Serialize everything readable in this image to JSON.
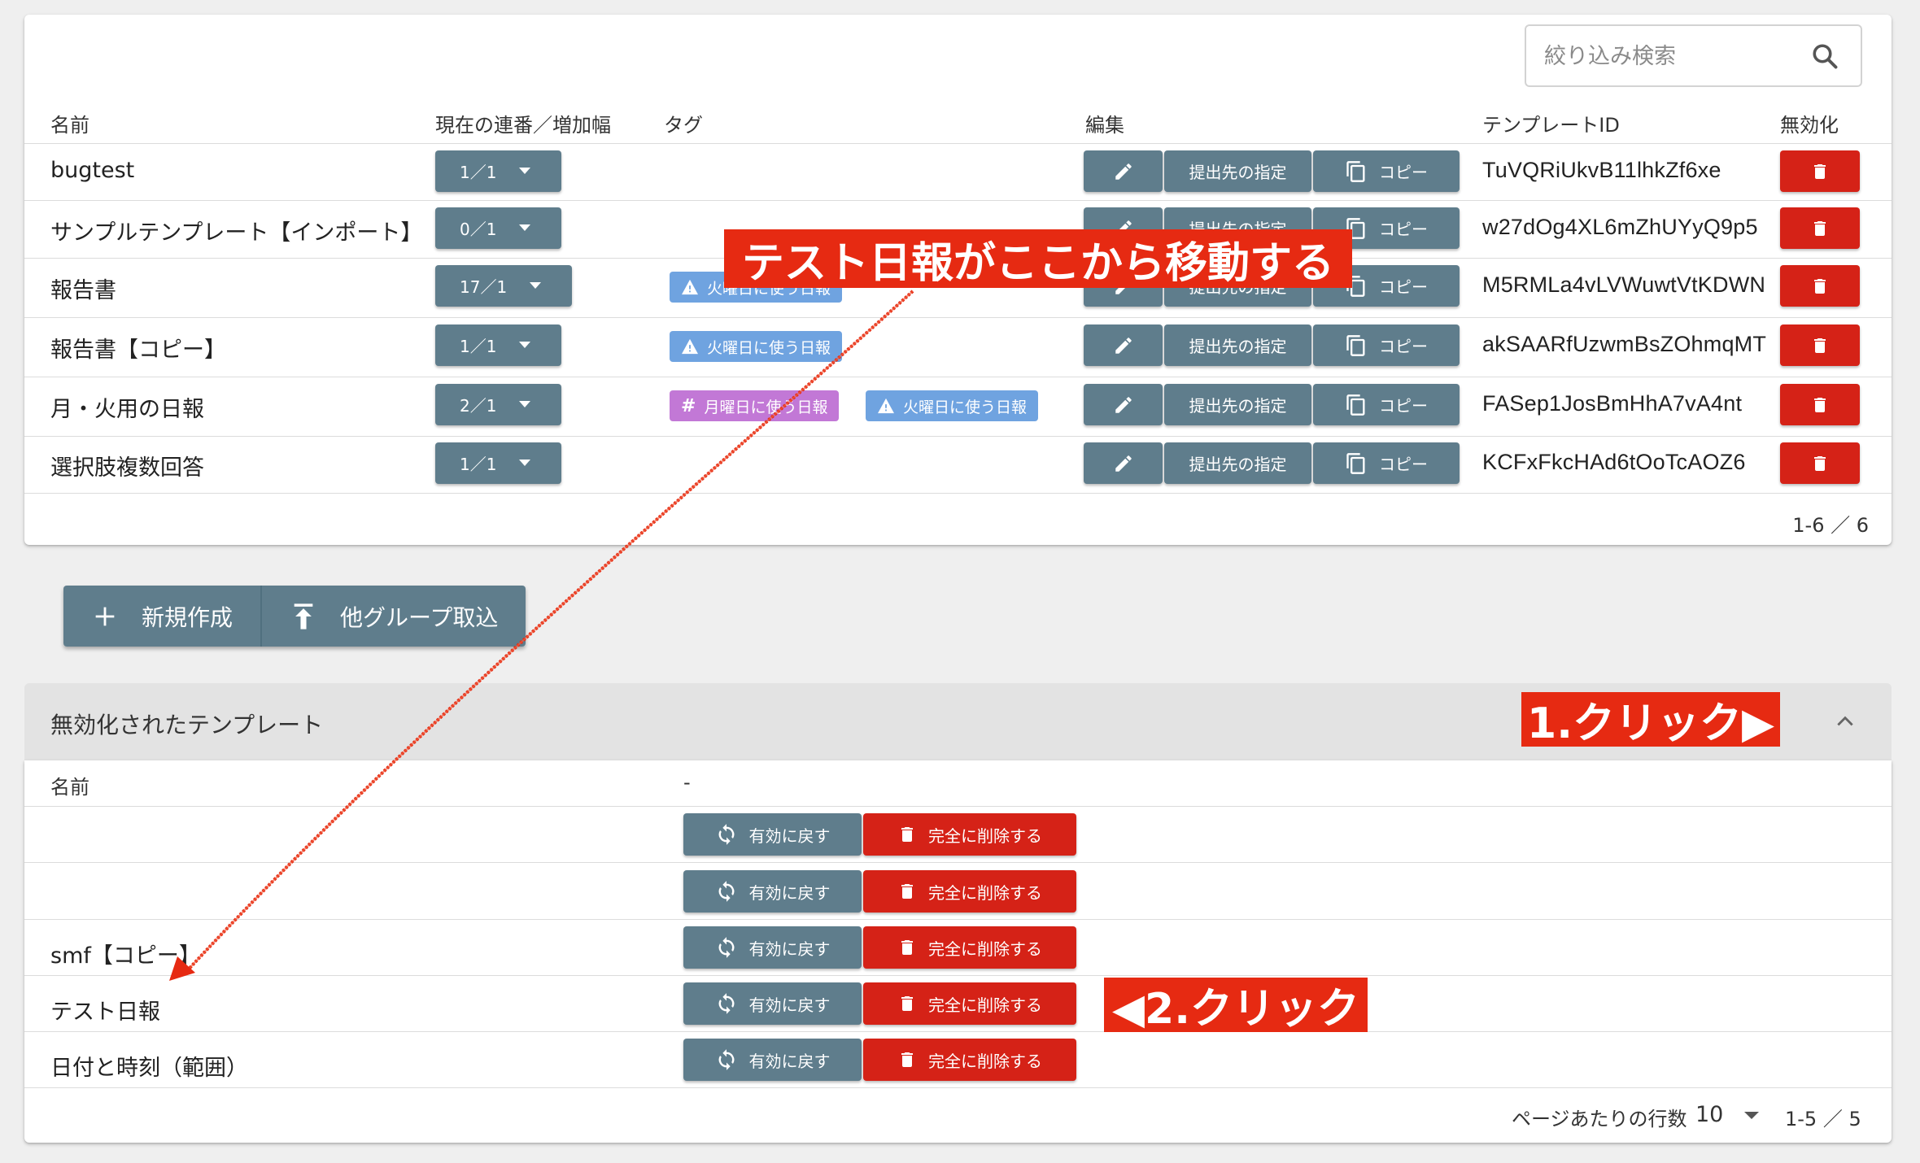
{
  "search": {
    "placeholder": "絞り込み検索",
    "icon": "search-icon"
  },
  "table": {
    "headers": [
      "名前",
      "現在の連番／増加幅",
      "タグ",
      "編集",
      "テンプレートID",
      "無効化"
    ],
    "rows": [
      {
        "name": "bugtest",
        "seq": "1／1",
        "tags": [],
        "id": "TuVQRiUkvB11lhkZf6xe"
      },
      {
        "name": "サンプルテンプレート【インポート】",
        "seq": "0／1",
        "tags": [],
        "id": "w27dOg4XL6mZhUYyQ9p5"
      },
      {
        "name": "報告書",
        "seq": "17／1",
        "tags": [
          {
            "label": "火曜日に使う日報",
            "type": "warning"
          }
        ],
        "id": "M5RMLa4vLVWuwtVtKDWN"
      },
      {
        "name": "報告書【コピー】",
        "seq": "1／1",
        "tags": [
          {
            "label": "火曜日に使う日報",
            "type": "warning"
          }
        ],
        "id": "akSAARfUzwmBsZOhmqMT"
      },
      {
        "name": "月・火用の日報",
        "seq": "2／1",
        "tags": [
          {
            "label": "月曜日に使う日報",
            "type": "hash"
          },
          {
            "label": "火曜日に使う日報",
            "type": "warning"
          }
        ],
        "id": "FASep1JosBmHhA7vA4nt"
      },
      {
        "name": "選択肢複数回答",
        "seq": "1／1",
        "tags": [],
        "id": "KCFxFkcHAd6tOoTcAOZ6"
      }
    ],
    "edit_buttons": {
      "destination": "提出先の指定",
      "copy": "コピー"
    },
    "pagination": "1-6 ／ 6"
  },
  "actions": {
    "new": "新規作成",
    "import": "他グループ取込"
  },
  "disabled_section": {
    "title": "無効化されたテンプレート",
    "headers": [
      "名前",
      "-"
    ],
    "rows": [
      "",
      "",
      "smf【コピー】",
      "テスト日報",
      "日付と時刻（範囲）"
    ],
    "restore_label": "有効に戻す",
    "delete_label": "完全に削除する",
    "rows_per_page_label": "ページあたりの行数",
    "rows_per_page": "10",
    "pagination": "1-5 ／ 5"
  },
  "annotations": {
    "move": "テスト日報がここから移動する",
    "click1": "1.クリック▶",
    "click2": "◀2.クリック"
  },
  "colors": {
    "primary": "#5f7d8c",
    "danger": "#d52217",
    "annotation": "#e62a12",
    "tag_blue": "#6fa3e0",
    "tag_purple": "#c278d6"
  }
}
